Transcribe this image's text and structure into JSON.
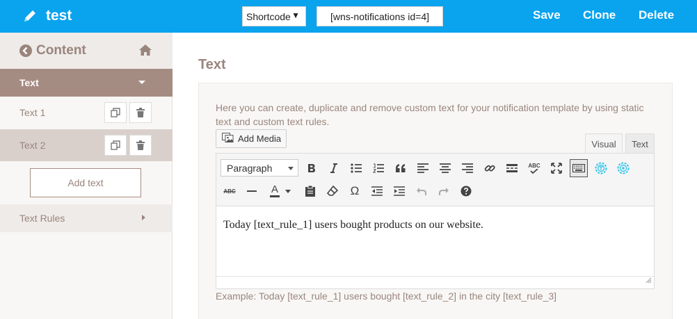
{
  "header": {
    "title": "test",
    "shortcode_select": "Shortcode",
    "shortcode_value": "[wns-notifications id=4]",
    "actions": {
      "save": "Save",
      "clone": "Clone",
      "delete": "Delete"
    }
  },
  "sidebar": {
    "title": "Content",
    "section": "Text",
    "items": [
      {
        "label": "Text 1"
      },
      {
        "label": "Text 2"
      }
    ],
    "add_button": "Add text",
    "rules": "Text Rules"
  },
  "main": {
    "title": "Text",
    "description": "Here you can create, duplicate and remove custom text for your notification template by using static text and custom text rules.",
    "add_media": "Add Media",
    "tabs": {
      "visual": "Visual",
      "text": "Text"
    },
    "format_select": "Paragraph",
    "content": "Today [text_rule_1] users bought products on our website.",
    "example": "Example: Today [text_rule_1] users bought [text_rule_2] in the city [text_rule_3]",
    "toolbar_labels": {
      "spellcheck": "ABC",
      "strike": "ABC",
      "text_color": "A"
    }
  },
  "colors": {
    "topbar": "#0aa3ee",
    "accent_brown": "#a58c82",
    "muted_text": "#9a857d",
    "icon_teal": "#38c6e8"
  }
}
